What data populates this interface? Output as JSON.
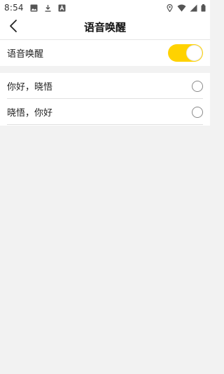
{
  "status_bar": {
    "time": "8:54",
    "left_icons": [
      "image-icon",
      "download-icon",
      "a-notification-icon"
    ],
    "right_icons": [
      "location-icon",
      "wifi-icon",
      "signal-icon",
      "battery-icon"
    ]
  },
  "app_bar": {
    "title": "语音唤醒",
    "back_icon": "chevron-left-icon"
  },
  "wake_setting": {
    "label": "语音唤醒",
    "enabled": true,
    "toggle_color": "#ffd200"
  },
  "phrases": {
    "items": [
      {
        "label": "你好，晓悟",
        "selected": false
      },
      {
        "label": "晓悟，你好",
        "selected": false
      }
    ]
  }
}
